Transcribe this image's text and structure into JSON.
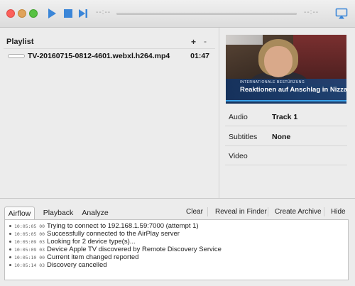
{
  "toolbar": {
    "time_elapsed": "--:--",
    "time_remaining": "--:--",
    "icons": {
      "play": "play-icon",
      "stop": "stop-icon",
      "next": "next-track-icon",
      "airplay": "airplay-icon"
    },
    "accent_color": "#3b86d8"
  },
  "playlist": {
    "title": "Playlist",
    "add_label": "+",
    "remove_label": "-",
    "items": [
      {
        "name": "TV-20160715-0812-4601.webxl.h264.mp4",
        "duration": "01:47"
      }
    ]
  },
  "preview": {
    "kicker": "INTERNATIONALE BESTÜRZUNG",
    "headline": "Reaktionen auf Anschlag in Nizza"
  },
  "inspector": {
    "rows": [
      {
        "label": "Audio",
        "value": "Track 1"
      },
      {
        "label": "Subtitles",
        "value": "None"
      },
      {
        "label": "Video",
        "value": ""
      }
    ]
  },
  "log": {
    "tabs": [
      "Airflow",
      "Playback",
      "Analyze"
    ],
    "active_tab": "Airflow",
    "actions": [
      "Clear",
      "Reveal in Finder",
      "Create Archive",
      "Hide"
    ],
    "entries": [
      {
        "time": "10:05:05 00",
        "text": "Trying to connect to 192.168.1.59:7000 (attempt 1)"
      },
      {
        "time": "10:05:05 00",
        "text": "Successfully connected to the AirPlay server"
      },
      {
        "time": "10:05:09 03",
        "text": "Looking for 2 device type(s)..."
      },
      {
        "time": "10:05:09 03",
        "text": "Device Apple TV discovered by Remote Discovery Service"
      },
      {
        "time": "10:05:10 00",
        "text": "Current item changed reported"
      },
      {
        "time": "10:05:14 03",
        "text": "Discovery cancelled"
      }
    ]
  }
}
